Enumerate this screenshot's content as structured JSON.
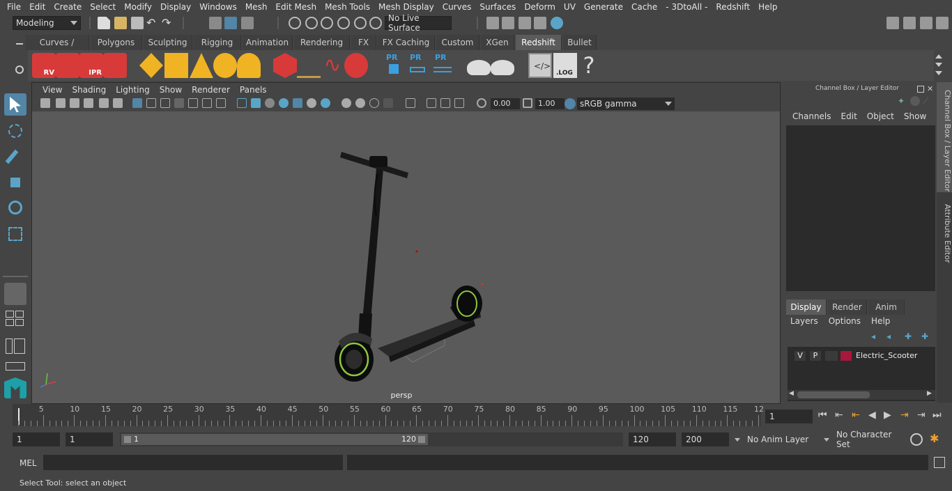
{
  "menus": [
    "File",
    "Edit",
    "Create",
    "Select",
    "Modify",
    "Display",
    "Windows",
    "Mesh",
    "Edit Mesh",
    "Mesh Tools",
    "Mesh Display",
    "Curves",
    "Surfaces",
    "Deform",
    "UV",
    "Generate",
    "Cache",
    "- 3DtoAll -",
    "Redshift",
    "Help"
  ],
  "statusline": {
    "mode": "Modeling",
    "live_surface": "No Live Surface"
  },
  "shelf_tabs": [
    "Curves / Surfaces",
    "Polygons",
    "Sculpting",
    "Rigging",
    "Animation",
    "Rendering",
    "FX",
    "FX Caching",
    "Custom",
    "XGen",
    "Redshift",
    "Bullet"
  ],
  "shelf_active": "Redshift",
  "shelf_labels": {
    "rv": "RV",
    "ipr": "IPR",
    "pr1": "PR",
    "pr2": "PR",
    "pr3": "PR",
    "log": ".LOG",
    "help": "?"
  },
  "viewport": {
    "menus": [
      "View",
      "Shading",
      "Lighting",
      "Show",
      "Renderer",
      "Panels"
    ],
    "exposure": "0.00",
    "gamma": "1.00",
    "colorspace": "sRGB gamma",
    "camera": "persp"
  },
  "channelbox": {
    "title": "Channel Box / Layer Editor",
    "menus": [
      "Channels",
      "Edit",
      "Object",
      "Show"
    ],
    "layer_tabs": [
      "Display",
      "Render",
      "Anim"
    ],
    "active_layer_tab": "Display",
    "layer_menus": [
      "Layers",
      "Options",
      "Help"
    ],
    "layer": {
      "v": "V",
      "p": "P",
      "name": "Electric_Scooter",
      "color": "#a8183a"
    }
  },
  "side_tabs": [
    "Channel Box / Layer Editor",
    "Attribute Editor"
  ],
  "timeline": {
    "ticks": [
      "5",
      "10",
      "15",
      "20",
      "25",
      "30",
      "35",
      "40",
      "45",
      "50",
      "55",
      "60",
      "65",
      "70",
      "75",
      "80",
      "85",
      "90",
      "95",
      "100",
      "105",
      "110",
      "115",
      "12"
    ],
    "current_frame_marker": "1",
    "current_frame": "1"
  },
  "range": {
    "start": "1",
    "playback_start": "1",
    "slider_start": "1",
    "slider_end": "120",
    "playback_end": "120",
    "end": "200",
    "anim_layer": "No Anim Layer",
    "character_set": "No Character Set"
  },
  "cmd": {
    "lang": "MEL"
  },
  "help": "Select Tool: select an object",
  "colors": {
    "accent_blue": "#5285a6",
    "redshift_red": "#d83a3a",
    "layer_red": "#a8183a",
    "green_wheel": "#8ec63f"
  }
}
